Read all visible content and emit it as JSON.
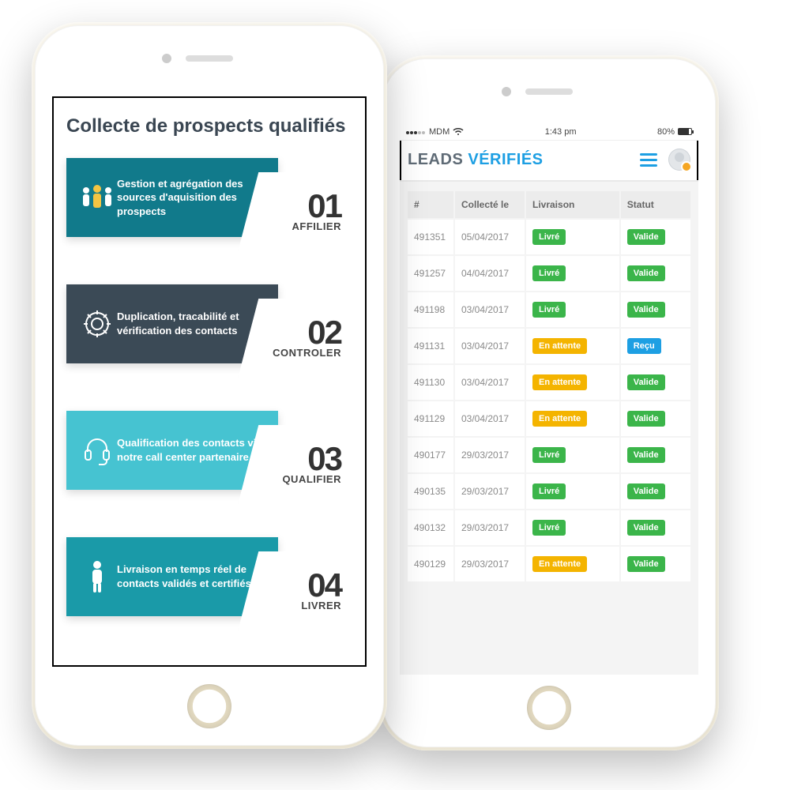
{
  "left": {
    "title": "Collecte de prospects qualifiés",
    "steps": [
      {
        "desc": "Gestion et agrégation des sources d'aquisition des prospects",
        "num": "01",
        "label": "AFFILIER"
      },
      {
        "desc": "Duplication, tracabilité et vérification des contacts",
        "num": "02",
        "label": "CONTROLER"
      },
      {
        "desc": "Qualification des contacts via notre call center partenaire",
        "num": "03",
        "label": "QUALIFIER"
      },
      {
        "desc": "Livraison en temps réel de contacts validés et certifiés",
        "num": "04",
        "label": "LIVRER"
      }
    ]
  },
  "right": {
    "status": {
      "carrier": "MDM",
      "time": "1:43 pm",
      "battery": "80%"
    },
    "brand": {
      "a": "LEADS",
      "b": "VÉRIFIÉS"
    },
    "columns": [
      "#",
      "Collecté le",
      "Livraison",
      "Statut"
    ],
    "badges": {
      "livre": "Livré",
      "attente": "En attente",
      "valide": "Valide",
      "recu": "Reçu"
    },
    "rows": [
      {
        "id": "491351",
        "date": "05/04/2017",
        "delivery": "livre",
        "status": "valide"
      },
      {
        "id": "491257",
        "date": "04/04/2017",
        "delivery": "livre",
        "status": "valide"
      },
      {
        "id": "491198",
        "date": "03/04/2017",
        "delivery": "livre",
        "status": "valide"
      },
      {
        "id": "491131",
        "date": "03/04/2017",
        "delivery": "attente",
        "status": "recu"
      },
      {
        "id": "491130",
        "date": "03/04/2017",
        "delivery": "attente",
        "status": "valide"
      },
      {
        "id": "491129",
        "date": "03/04/2017",
        "delivery": "attente",
        "status": "valide"
      },
      {
        "id": "490177",
        "date": "29/03/2017",
        "delivery": "livre",
        "status": "valide"
      },
      {
        "id": "490135",
        "date": "29/03/2017",
        "delivery": "livre",
        "status": "valide"
      },
      {
        "id": "490132",
        "date": "29/03/2017",
        "delivery": "livre",
        "status": "valide"
      },
      {
        "id": "490129",
        "date": "29/03/2017",
        "delivery": "attente",
        "status": "valide"
      }
    ]
  }
}
